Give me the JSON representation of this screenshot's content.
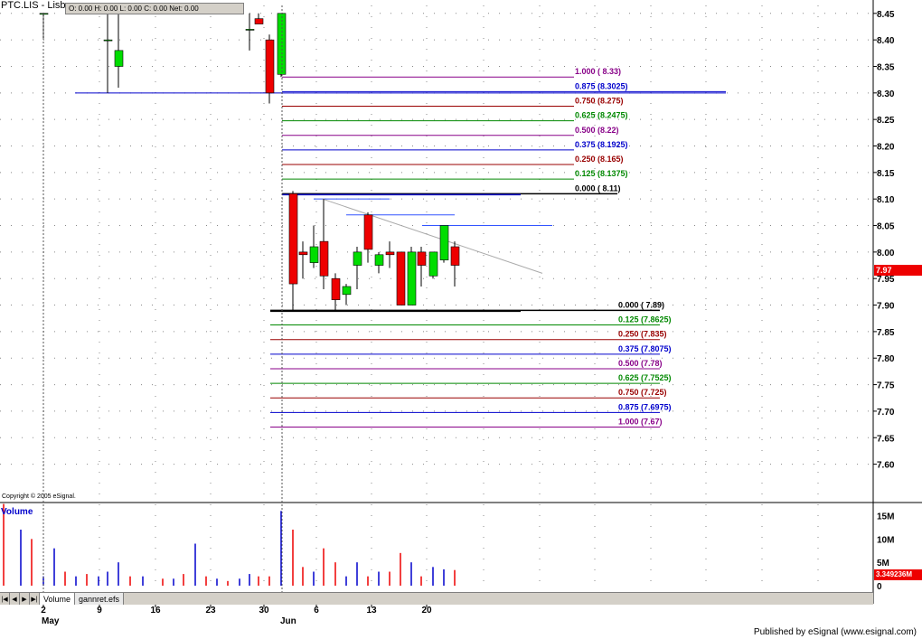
{
  "symbol": "PTC.LIS - Lisbo",
  "ohlc": {
    "o": "O: 0.00",
    "h": "H: 0.00",
    "l": "L: 0.00",
    "c": "C: 0.00",
    "net": "Net: 0.00"
  },
  "copyright": "Copyright © 2005 eSignal.",
  "published": "Published by eSignal (www.esignal.com)",
  "volume_title": "Volume",
  "tabs": [
    "Volume",
    "gannret.efs"
  ],
  "last_price_tag": "7.97",
  "last_volume_tag": "3.349236M",
  "colors": {
    "up": "#00dd00",
    "down": "#ee0000",
    "blue": "#0000cc",
    "red": "#990000",
    "green": "#008800",
    "purple": "#880088",
    "black": "#000000",
    "grid": "#888888"
  },
  "chart_data": {
    "type": "candlestick",
    "price_axis": {
      "ticks": [
        "8.45",
        "8.40",
        "8.35",
        "8.30",
        "8.25",
        "8.20",
        "8.15",
        "8.10",
        "8.05",
        "8.00",
        "7.95",
        "7.90",
        "7.85",
        "7.80",
        "7.75",
        "7.70",
        "7.65",
        "7.60"
      ],
      "range": [
        7.555,
        8.465
      ]
    },
    "volume_axis": {
      "ticks": [
        "15M",
        "10M",
        "5M",
        "0"
      ],
      "range": [
        0,
        18000000
      ]
    },
    "x_axis": {
      "tick_labels": [
        "2",
        "9",
        "16",
        "23",
        "30",
        "6",
        "13",
        "20"
      ],
      "month_labels": [
        "May",
        "Jun"
      ]
    },
    "bars": [
      {
        "date": "May 2",
        "open": 8.45,
        "high": 8.45,
        "low": 8.4,
        "close": 8.45,
        "volume": 2000000
      },
      {
        "date": "May 10",
        "open": 8.4,
        "high": 8.45,
        "low": 8.3,
        "close": 8.4,
        "volume": 3000000
      },
      {
        "date": "May 11",
        "open": 8.35,
        "high": 8.45,
        "low": 8.31,
        "close": 8.38,
        "volume": 5000000
      },
      {
        "date": "May 27",
        "open": 8.42,
        "high": 8.45,
        "low": 8.38,
        "close": 8.42,
        "volume": 2500000
      },
      {
        "date": "May 28",
        "open": 8.44,
        "high": 8.45,
        "low": 8.43,
        "close": 8.43,
        "volume": 2000000
      },
      {
        "date": "May 29",
        "open": 8.4,
        "high": 8.41,
        "low": 8.28,
        "close": 8.3,
        "volume": 2000000
      },
      {
        "date": "May 30",
        "open": 8.335,
        "high": 8.45,
        "low": 8.33,
        "close": 8.45,
        "volume": 16000000
      },
      {
        "date": "May 31",
        "open": 8.11,
        "high": 8.115,
        "low": 7.89,
        "close": 7.94,
        "volume": 12000000
      },
      {
        "date": "Jun 1",
        "open": 8.0,
        "high": 8.02,
        "low": 7.95,
        "close": 7.995,
        "volume": 4000000
      },
      {
        "date": "Jun 2",
        "open": 7.98,
        "high": 8.05,
        "low": 7.97,
        "close": 8.01,
        "volume": 3000000
      },
      {
        "date": "Jun 3",
        "open": 8.02,
        "high": 8.1,
        "low": 7.93,
        "close": 7.955,
        "volume": 8000000
      },
      {
        "date": "Jun 6",
        "open": 7.95,
        "high": 7.96,
        "low": 7.89,
        "close": 7.91,
        "volume": 5000000
      },
      {
        "date": "Jun 7",
        "open": 7.92,
        "high": 7.94,
        "low": 7.9,
        "close": 7.935,
        "volume": 2000000
      },
      {
        "date": "Jun 8",
        "open": 7.975,
        "high": 8.01,
        "low": 7.93,
        "close": 8.0,
        "volume": 5000000
      },
      {
        "date": "Jun 9",
        "open": 8.07,
        "high": 8.075,
        "low": 7.98,
        "close": 8.005,
        "volume": 2000000
      },
      {
        "date": "Jun 10",
        "open": 7.975,
        "high": 8.0,
        "low": 7.96,
        "close": 7.995,
        "volume": 3000000
      },
      {
        "date": "Jun 13",
        "open": 8.0,
        "high": 8.02,
        "low": 7.97,
        "close": 7.995,
        "volume": 3000000
      },
      {
        "date": "Jun 14",
        "open": 8.0,
        "high": 8.0,
        "low": 7.9,
        "close": 7.9,
        "volume": 7000000
      },
      {
        "date": "Jun 15",
        "open": 7.9,
        "high": 8.01,
        "low": 7.9,
        "close": 8.0,
        "volume": 5000000
      },
      {
        "date": "Jun 16",
        "open": 8.0,
        "high": 8.01,
        "low": 7.935,
        "close": 7.975,
        "volume": 2000000
      },
      {
        "date": "Jun 17",
        "open": 7.955,
        "high": 8.0,
        "low": 7.95,
        "close": 8.0,
        "volume": 4000000
      },
      {
        "date": "Jun 20",
        "open": 7.985,
        "high": 8.05,
        "low": 7.98,
        "close": 8.05,
        "volume": 3500000
      },
      {
        "date": "Jun 21",
        "open": 8.01,
        "high": 8.02,
        "low": 7.935,
        "close": 7.975,
        "volume": 3349236
      }
    ],
    "fib_upper": [
      {
        "label": "1.000 ( 8.33)",
        "price": 8.33,
        "color": "purple"
      },
      {
        "label": "0.875 (8.3025)",
        "price": 8.3025,
        "color": "blue"
      },
      {
        "label": "0.750 (8.275)",
        "price": 8.275,
        "color": "red"
      },
      {
        "label": "0.625 (8.2475)",
        "price": 8.2475,
        "color": "green"
      },
      {
        "label": "0.500 (8.22)",
        "price": 8.22,
        "color": "purple"
      },
      {
        "label": "0.375 (8.1925)",
        "price": 8.1925,
        "color": "blue"
      },
      {
        "label": "0.250 (8.165)",
        "price": 8.165,
        "color": "red"
      },
      {
        "label": "0.125 (8.1375)",
        "price": 8.1375,
        "color": "green"
      },
      {
        "label": "0.000 ( 8.11)",
        "price": 8.11,
        "color": "black"
      }
    ],
    "fib_lower": [
      {
        "label": "0.000 ( 7.89)",
        "price": 7.89,
        "color": "black"
      },
      {
        "label": "0.125 (7.8625)",
        "price": 7.8625,
        "color": "green"
      },
      {
        "label": "0.250 (7.835)",
        "price": 7.835,
        "color": "red"
      },
      {
        "label": "0.375 (7.8075)",
        "price": 7.8075,
        "color": "blue"
      },
      {
        "label": "0.500 (7.78)",
        "price": 7.78,
        "color": "purple"
      },
      {
        "label": "0.625 (7.7525)",
        "price": 7.7525,
        "color": "green"
      },
      {
        "label": "0.750 (7.725)",
        "price": 7.725,
        "color": "red"
      },
      {
        "label": "0.875 (7.6975)",
        "price": 7.6975,
        "color": "blue"
      },
      {
        "label": "1.000 (7.67)",
        "price": 7.67,
        "color": "purple"
      }
    ],
    "support_line": 8.3,
    "resistance_segments": [
      8.1,
      8.07,
      8.05
    ],
    "trendline": {
      "from_date": "Jun 2",
      "from_price": 8.1,
      "to_date": "Jun 23",
      "to_price": 7.96
    }
  }
}
